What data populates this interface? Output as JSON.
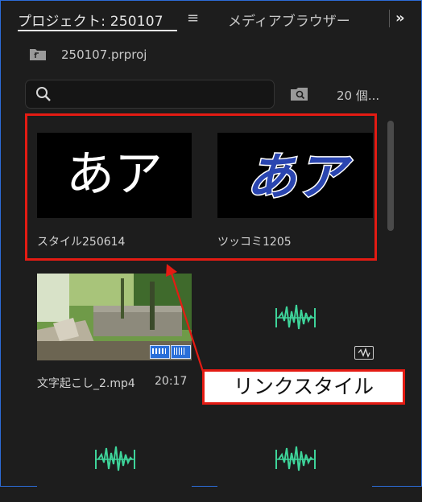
{
  "tabs": {
    "project": "プロジェクト: 250107",
    "menu_icon": "≡",
    "media_browser": "メディアブラウザー",
    "overflow_icon": "»"
  },
  "path": {
    "icon": "folder-up-icon",
    "project_name": "250107.prproj"
  },
  "search": {
    "placeholder": "",
    "value": "",
    "item_count": "20 個..."
  },
  "items": [
    {
      "label": "スタイル250614",
      "type": "graphic-style",
      "preview_text": "あア"
    },
    {
      "label": "ツッコミ1205",
      "type": "graphic-style",
      "preview_text": "あア"
    },
    {
      "label": "文字起こし_2.mp4",
      "duration": "20:17",
      "type": "video"
    },
    {
      "label": "",
      "type": "audio"
    },
    {
      "label": "",
      "type": "audio"
    },
    {
      "label": "",
      "type": "audio"
    }
  ],
  "annotation": {
    "callout": "リンクスタイル"
  },
  "colors": {
    "accent_blue": "#2c6bd6",
    "annotation_red": "#e41b13",
    "audio_green": "#3ed49a"
  }
}
